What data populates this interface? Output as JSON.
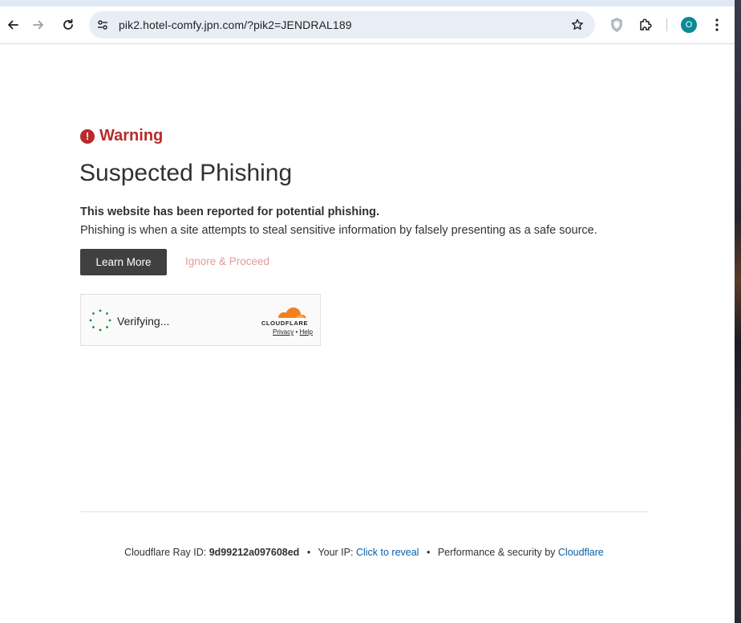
{
  "browser": {
    "url": "pik2.hotel-comfy.jpn.com/?pik2=JENDRAL189",
    "profile_initial": "O"
  },
  "page": {
    "warning_label": "Warning",
    "title": "Suspected Phishing",
    "lead": "This website has been reported for potential phishing.",
    "description": "Phishing is when a site attempts to steal sensitive information by falsely presenting as a safe source.",
    "learn_more": "Learn More",
    "ignore_proceed": "Ignore & Proceed"
  },
  "widget": {
    "status": "Verifying...",
    "brand": "CLOUDFLARE",
    "privacy": "Privacy",
    "bullet": "•",
    "help": "Help"
  },
  "footer": {
    "ray_label": "Cloudflare Ray ID:",
    "ray_id": "9d99212a097608ed",
    "ip_label": "Your IP:",
    "ip_link": "Click to reveal",
    "perf_label": "Performance & security by",
    "perf_link": "Cloudflare",
    "bullet": "•"
  },
  "colors": {
    "warning": "#b82b2b",
    "button_dark": "#404040",
    "link": "#0b5fa8",
    "cloudflare_orange": "#f38020"
  }
}
